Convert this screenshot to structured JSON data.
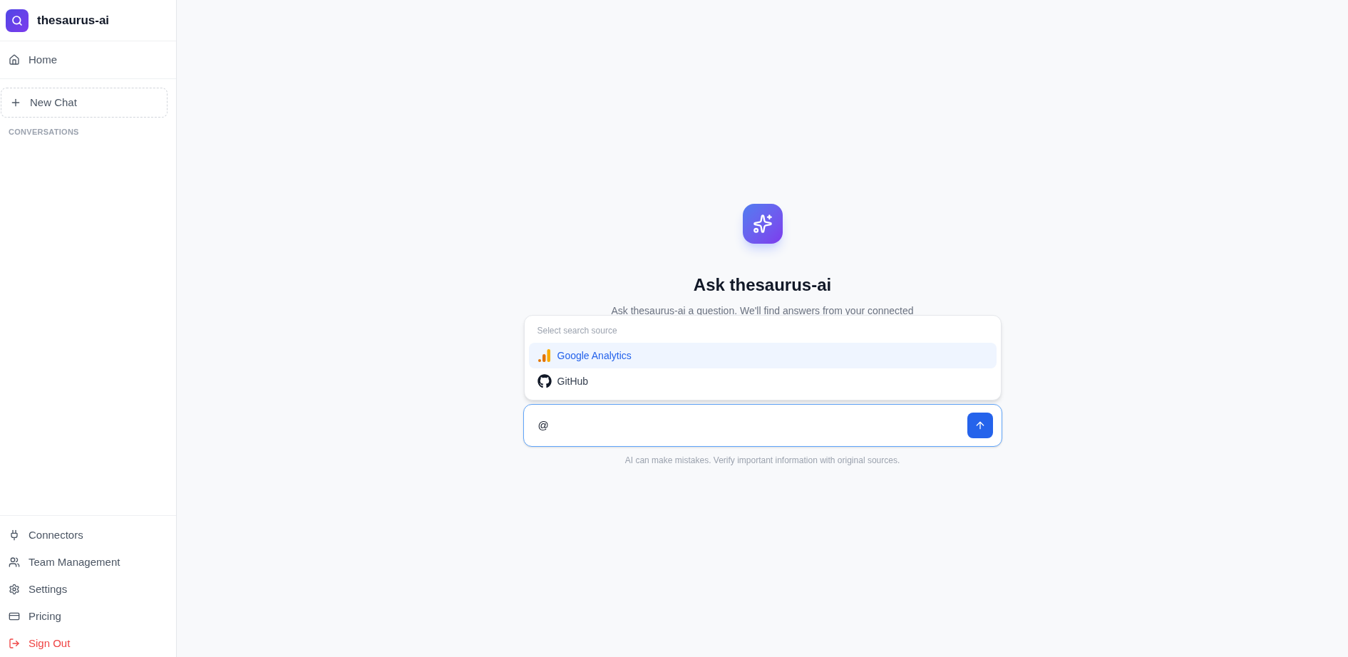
{
  "brand": {
    "name": "thesaurus-ai"
  },
  "sidebar": {
    "top_items": [
      {
        "label": "Home"
      }
    ],
    "new_chat": {
      "label": "New Chat"
    },
    "section_heading": "CONVERSATIONS",
    "bottom_items": [
      {
        "label": "Connectors",
        "kind": "normal"
      },
      {
        "label": "Team Management",
        "kind": "normal"
      },
      {
        "label": "Settings",
        "kind": "normal"
      },
      {
        "label": "Pricing",
        "kind": "normal"
      },
      {
        "label": "Sign Out",
        "kind": "danger"
      }
    ]
  },
  "main": {
    "title": "Ask thesaurus-ai",
    "subtitle": "Ask thesaurus-ai a question. We'll find answers from your connected",
    "source_menu": {
      "heading": "Select search source",
      "items": [
        {
          "label": "Google Analytics",
          "selected": true
        },
        {
          "label": "GitHub",
          "selected": false
        }
      ]
    },
    "input": {
      "value": "@"
    },
    "disclaimer": "AI can make mistakes. Verify important information with original sources."
  }
}
